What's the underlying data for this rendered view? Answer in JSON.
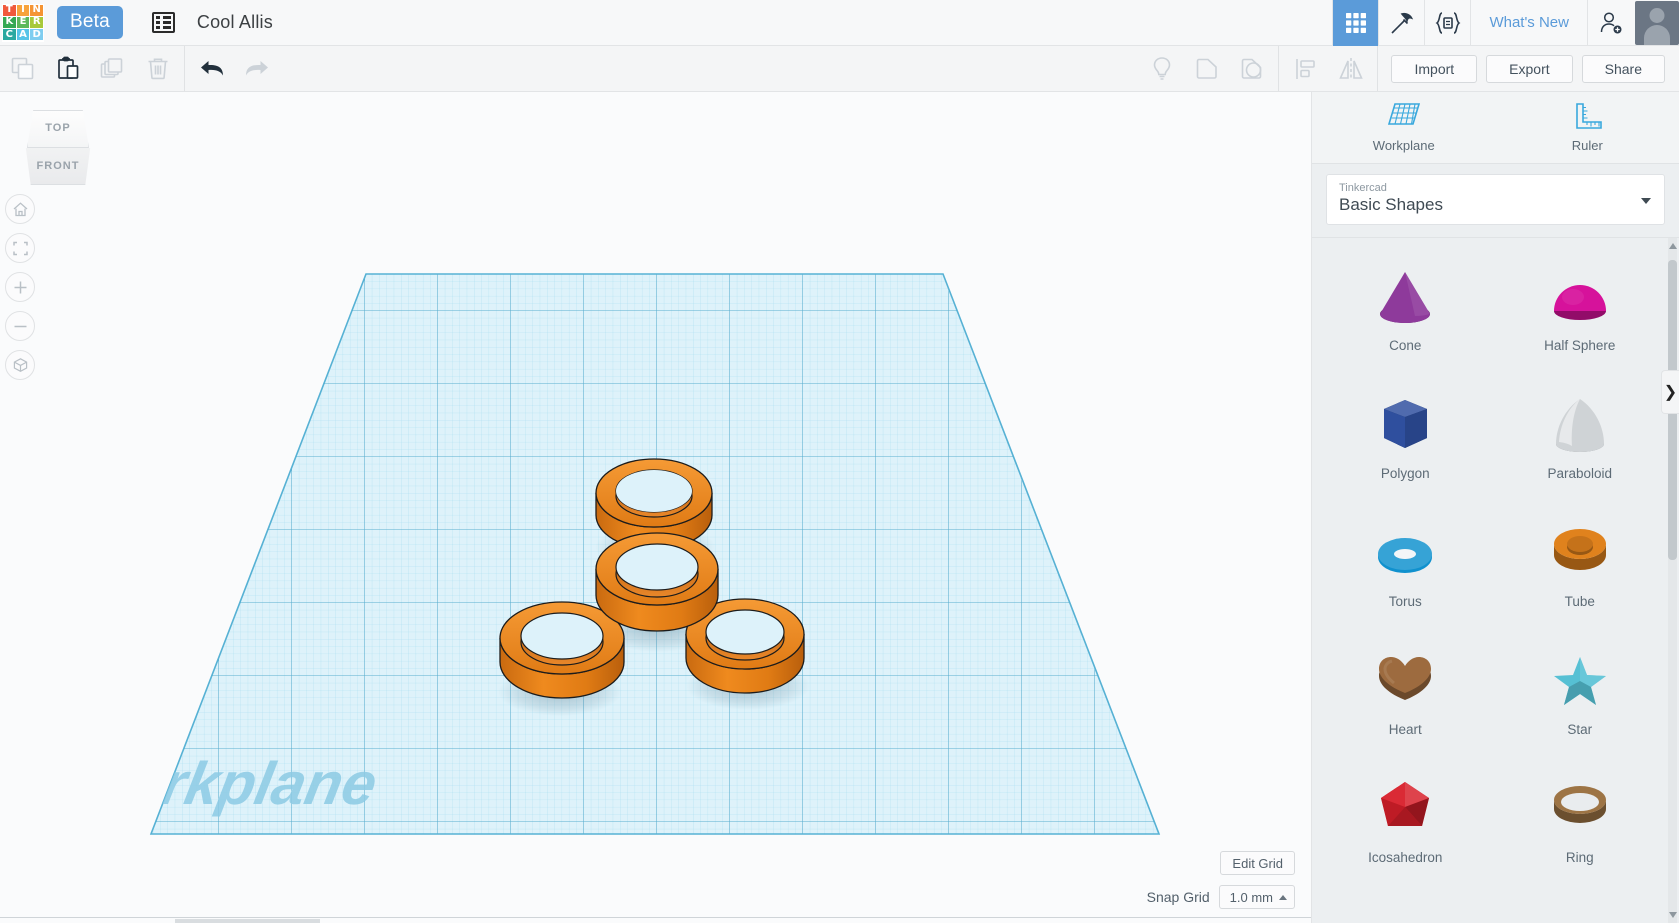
{
  "app": {
    "brand_letters": [
      "T",
      "I",
      "N",
      "K",
      "E",
      "R",
      "C",
      "A",
      "D"
    ],
    "brand_colors": [
      "#f0593c",
      "#f7a33c",
      "#f59433",
      "#34a853",
      "#5cb85c",
      "#a8c93a",
      "#2aa8a0",
      "#56c4e8",
      "#7fcdf0"
    ],
    "beta_label": "Beta",
    "document_title": "Cool Allis",
    "whats_new_label": "What's New",
    "accent_blue": "#5b9bd9"
  },
  "topbar": {
    "icons": [
      {
        "name": "grid-apps-icon",
        "active": true
      },
      {
        "name": "minecraft-pickaxe-icon",
        "active": false
      },
      {
        "name": "codeblocks-icon",
        "active": false
      }
    ],
    "add-person_label": "Add person",
    "avatar_label": "Account avatar"
  },
  "toolbar": {
    "copy_label": "Copy",
    "paste_label": "Paste",
    "duplicate_label": "Duplicate",
    "delete_label": "Delete",
    "undo_label": "Undo",
    "redo_label": "Redo",
    "lightbulb_label": "Hints",
    "group_label": "Group",
    "ungroup_label": "Ungroup",
    "align_label": "Align",
    "mirror_label": "Mirror",
    "import_label": "Import",
    "export_label": "Export",
    "share_label": "Share"
  },
  "canvas": {
    "viewcube": {
      "top_label": "TOP",
      "front_label": "FRONT"
    },
    "nav_buttons": [
      {
        "name": "home-view-button",
        "glyph": "home"
      },
      {
        "name": "fit-to-view-button",
        "glyph": "fit"
      },
      {
        "name": "zoom-in-button",
        "glyph": "plus"
      },
      {
        "name": "zoom-out-button",
        "glyph": "minus"
      },
      {
        "name": "perspective-toggle-button",
        "glyph": "cube"
      }
    ],
    "workplane_watermark": "Workplane",
    "edit_grid_label": "Edit Grid",
    "snap_grid_label": "Snap Grid",
    "snap_grid_value": "1.0 mm",
    "grid_color": "#6ec6e8",
    "grid_fill": "#d9f0fa",
    "model_color": "#e8821e",
    "model_name": "fidget-spinner",
    "model_parts": 4
  },
  "right_panel": {
    "tools": [
      {
        "label": "Workplane",
        "icon": "workplane-icon"
      },
      {
        "label": "Ruler",
        "icon": "ruler-icon"
      }
    ],
    "library_source": "Tinkercad",
    "library_name": "Basic Shapes",
    "shapes": [
      {
        "label": "Cone",
        "color": "#8e3a9b",
        "art": "cone"
      },
      {
        "label": "Half Sphere",
        "color": "#d6129b",
        "art": "halfsphere"
      },
      {
        "label": "Polygon",
        "color": "#2f4f9e",
        "art": "polygon"
      },
      {
        "label": "Paraboloid",
        "color": "#cfd3d6",
        "art": "paraboloid"
      },
      {
        "label": "Torus",
        "color": "#1091ce",
        "art": "torus"
      },
      {
        "label": "Tube",
        "color": "#e0821d",
        "art": "tube"
      },
      {
        "label": "Heart",
        "color": "#9d6b3f",
        "art": "heart"
      },
      {
        "label": "Star",
        "color": "#56c0d4",
        "art": "star"
      },
      {
        "label": "Icosahedron",
        "color": "#d81f2a",
        "art": "icosahedron"
      },
      {
        "label": "Ring",
        "color": "#9d7445",
        "art": "ring"
      }
    ]
  }
}
